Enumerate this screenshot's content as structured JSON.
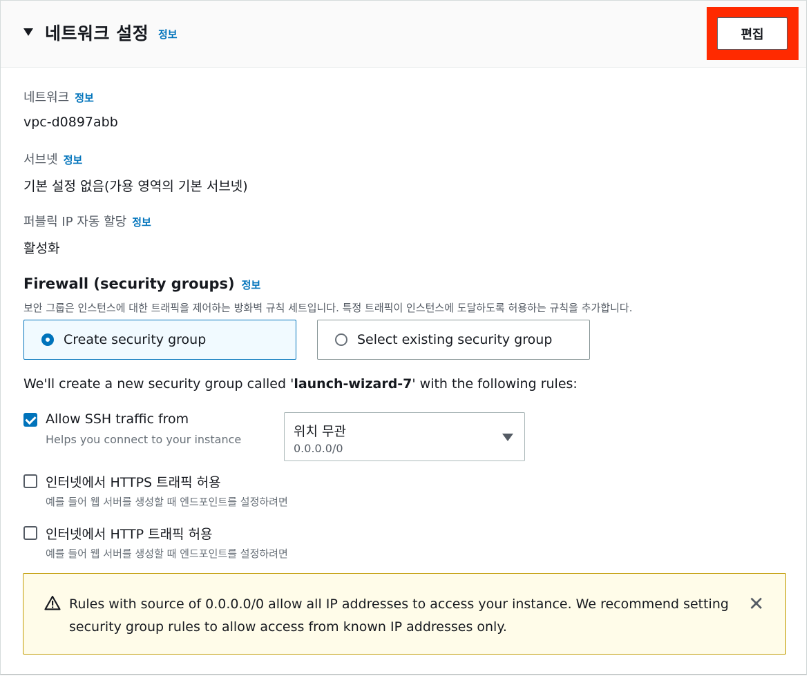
{
  "header": {
    "title": "네트워크 설정",
    "info": "정보",
    "edit_label": "편집"
  },
  "network": {
    "label": "네트워크",
    "info": "정보",
    "value": "vpc-d0897abb"
  },
  "subnet": {
    "label": "서브넷",
    "info": "정보",
    "value": "기본 설정 없음(가용 영역의 기본 서브넷)"
  },
  "public_ip": {
    "label": "퍼블릭 IP 자동 할당",
    "info": "정보",
    "value": "활성화"
  },
  "firewall": {
    "title": "Firewall (security groups)",
    "info": "정보",
    "description": "보안 그룹은 인스턴스에 대한 트래픽을 제어하는 방화벽 규칙 세트입니다. 특정 트래픽이 인스턴스에 도달하도록 허용하는 규칙을 추가합니다.",
    "options": [
      {
        "label": "Create security group",
        "selected": true
      },
      {
        "label": "Select existing security group",
        "selected": false
      }
    ],
    "create_note_prefix": "We'll create a new security group called '",
    "create_note_name": "launch-wizard-7",
    "create_note_suffix": "' with the following rules:"
  },
  "rules": [
    {
      "label": "Allow SSH traffic from",
      "hint": "Helps you connect to your instance",
      "checked": true
    },
    {
      "label": "인터넷에서 HTTPS 트래픽 허용",
      "hint": "예를 들어 웹 서버를 생성할 때 엔드포인트를 설정하려면",
      "checked": false
    },
    {
      "label": "인터넷에서 HTTP 트래픽 허용",
      "hint": "예를 들어 웹 서버를 생성할 때 엔드포인트를 설정하려면",
      "checked": false
    }
  ],
  "ssh_source": {
    "selected": "위치 무관",
    "sub": "0.0.0.0/0"
  },
  "alert": {
    "text": "Rules with source of 0.0.0.0/0 allow all IP addresses to access your instance. We recommend setting security group rules to allow access from known IP addresses only.",
    "close_glyph": "✕"
  },
  "colors": {
    "accent": "#0073bb",
    "highlight": "#ff2a00",
    "warning_bg": "#fffce9",
    "warning_border": "#c09a00"
  }
}
